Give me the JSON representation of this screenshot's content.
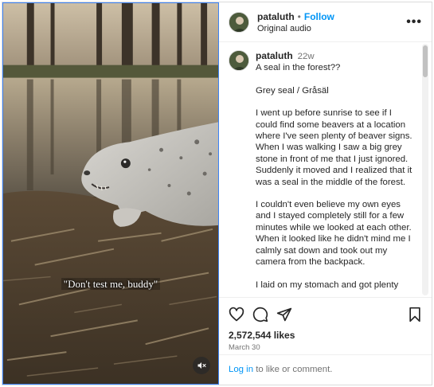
{
  "post": {
    "username": "pataluth",
    "follow_label": "Follow",
    "separator": "•",
    "audio": "Original audio",
    "more_label": "•••"
  },
  "media": {
    "overlay_caption": "\"Don't test me, buddy\"",
    "muted": true
  },
  "comment": {
    "username": "pataluth",
    "time": "22w",
    "paragraphs": [
      "A seal in the forest??",
      "Grey seal / Gråsäl",
      "I went up before sunrise to see if I could find some beavers at a location where I've seen plenty of beaver signs. When I was walking I saw a big grey stone in front of me that I just ignored. Suddenly it moved and I realized that it was a seal in the middle of the forest.",
      "I couldn't even believe my own eyes and I stayed completely still for a few minutes while we looked at each other. When it looked like he didn't mind me I calmly sat down and took out my camera from the backpack.",
      "I laid on my stomach and got plenty"
    ]
  },
  "actions": {
    "likes": "2,572,544 likes",
    "date": "March 30"
  },
  "login": {
    "link": "Log in",
    "rest": " to like or comment."
  }
}
